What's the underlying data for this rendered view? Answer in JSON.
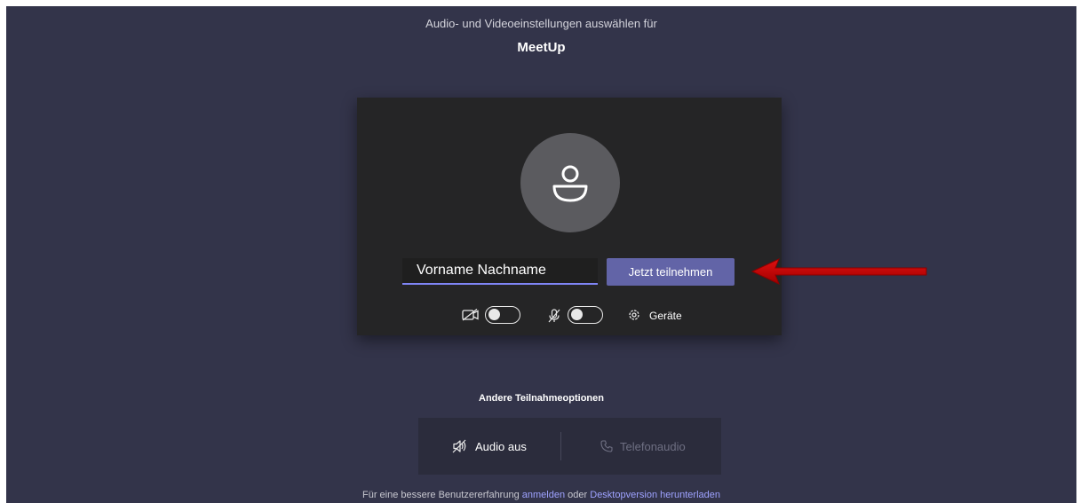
{
  "header": {
    "subtitle": "Audio- und Videoeinstellungen auswählen für",
    "meeting_name": "MeetUp"
  },
  "prejoin": {
    "name_input_value": "Vorname Nachname",
    "join_button_label": "Jetzt teilnehmen",
    "camera_toggle_on": false,
    "mic_toggle_on": false,
    "devices_label": "Geräte"
  },
  "other_options": {
    "title": "Andere Teilnahmeoptionen",
    "audio_off_label": "Audio aus",
    "phone_audio_label": "Telefonaudio"
  },
  "footer": {
    "prefix": "Für eine bessere Benutzererfahrung",
    "signin_link": "anmelden",
    "middle": "oder",
    "download_link": "Desktopversion herunterladen"
  },
  "annotation": {
    "arrow_color": "#c00000"
  },
  "colors": {
    "background": "#33344a",
    "card": "#252526",
    "accent": "#6264a7",
    "link": "#9ea2ff"
  }
}
